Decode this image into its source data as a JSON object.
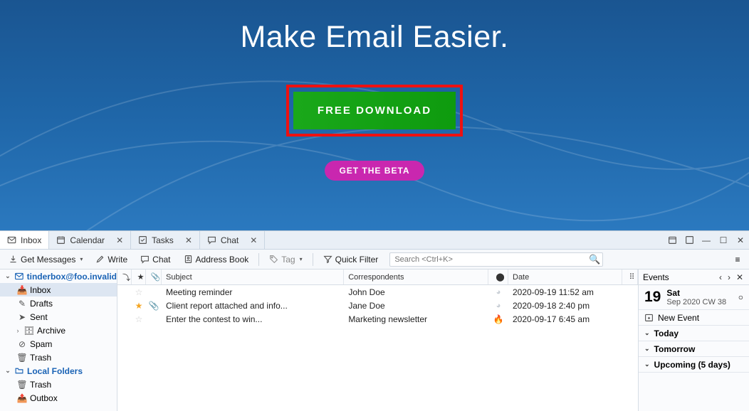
{
  "hero": {
    "headline": "Make Email Easier.",
    "download_label": "FREE DOWNLOAD",
    "beta_label": "GET THE BETA"
  },
  "tabs": [
    {
      "icon": "mail",
      "label": "Inbox",
      "close": false,
      "active": true
    },
    {
      "icon": "calendar",
      "label": "Calendar",
      "close": true
    },
    {
      "icon": "tasks",
      "label": "Tasks",
      "close": true
    },
    {
      "icon": "chat",
      "label": "Chat",
      "close": true
    }
  ],
  "toolbar": {
    "get_messages": "Get Messages",
    "write": "Write",
    "chat": "Chat",
    "address_book": "Address Book",
    "tag": "Tag",
    "quick_filter": "Quick Filter",
    "search_placeholder": "Search <Ctrl+K>"
  },
  "sidebar": {
    "account": "tinderbox@foo.invalid",
    "folders": [
      "Inbox",
      "Drafts",
      "Sent",
      "Archive",
      "Spam",
      "Trash"
    ],
    "local_label": "Local Folders",
    "local": [
      "Trash",
      "Outbox"
    ]
  },
  "columns": {
    "subject": "Subject",
    "correspondents": "Correspondents",
    "date": "Date"
  },
  "messages": [
    {
      "star": false,
      "att": false,
      "subject": "Meeting reminder",
      "from": "John Doe",
      "hot": "clock",
      "date": "2020-09-19 11:52 am"
    },
    {
      "star": true,
      "att": true,
      "subject": "Client report attached and info...",
      "from": "Jane Doe",
      "hot": "clock",
      "date": "2020-09-18 2:40 pm"
    },
    {
      "star": false,
      "att": false,
      "subject": "Enter the contest to win...",
      "from": "Marketing newsletter",
      "hot": "flame",
      "date": "2020-09-17 6:45 am"
    }
  ],
  "events": {
    "title": "Events",
    "day": "19",
    "dow": "Sat",
    "sub": "Sep 2020 CW 38",
    "new_event": "New Event",
    "sections": [
      "Today",
      "Tomorrow",
      "Upcoming (5 days)"
    ]
  }
}
